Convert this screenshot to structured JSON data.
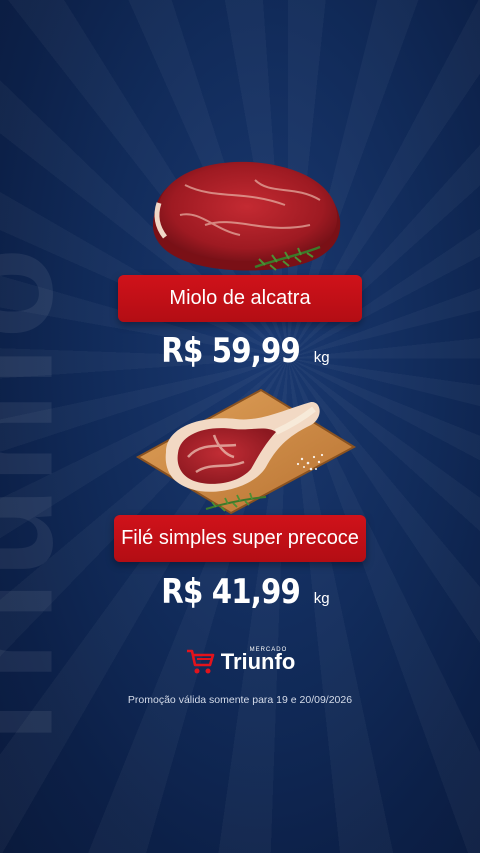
{
  "watermark": {
    "text": "Triunfo"
  },
  "products": [
    {
      "name": "Miolo de alcatra",
      "price": "R$ 59,99",
      "unit": "kg"
    },
    {
      "name": "Filé simples super precoce",
      "price": "R$ 41,99",
      "unit": "kg"
    }
  ],
  "brand": {
    "small": "MERCADO",
    "name": "Triunfo"
  },
  "note": "Promoção válida somente para 19 e 20/09/2026",
  "colors": {
    "background": "#0f2752",
    "label": "#c4101a",
    "text": "#ffffff"
  },
  "icons": [
    "shopping-cart-icon",
    "steak-image",
    "ribeye-board-image"
  ]
}
